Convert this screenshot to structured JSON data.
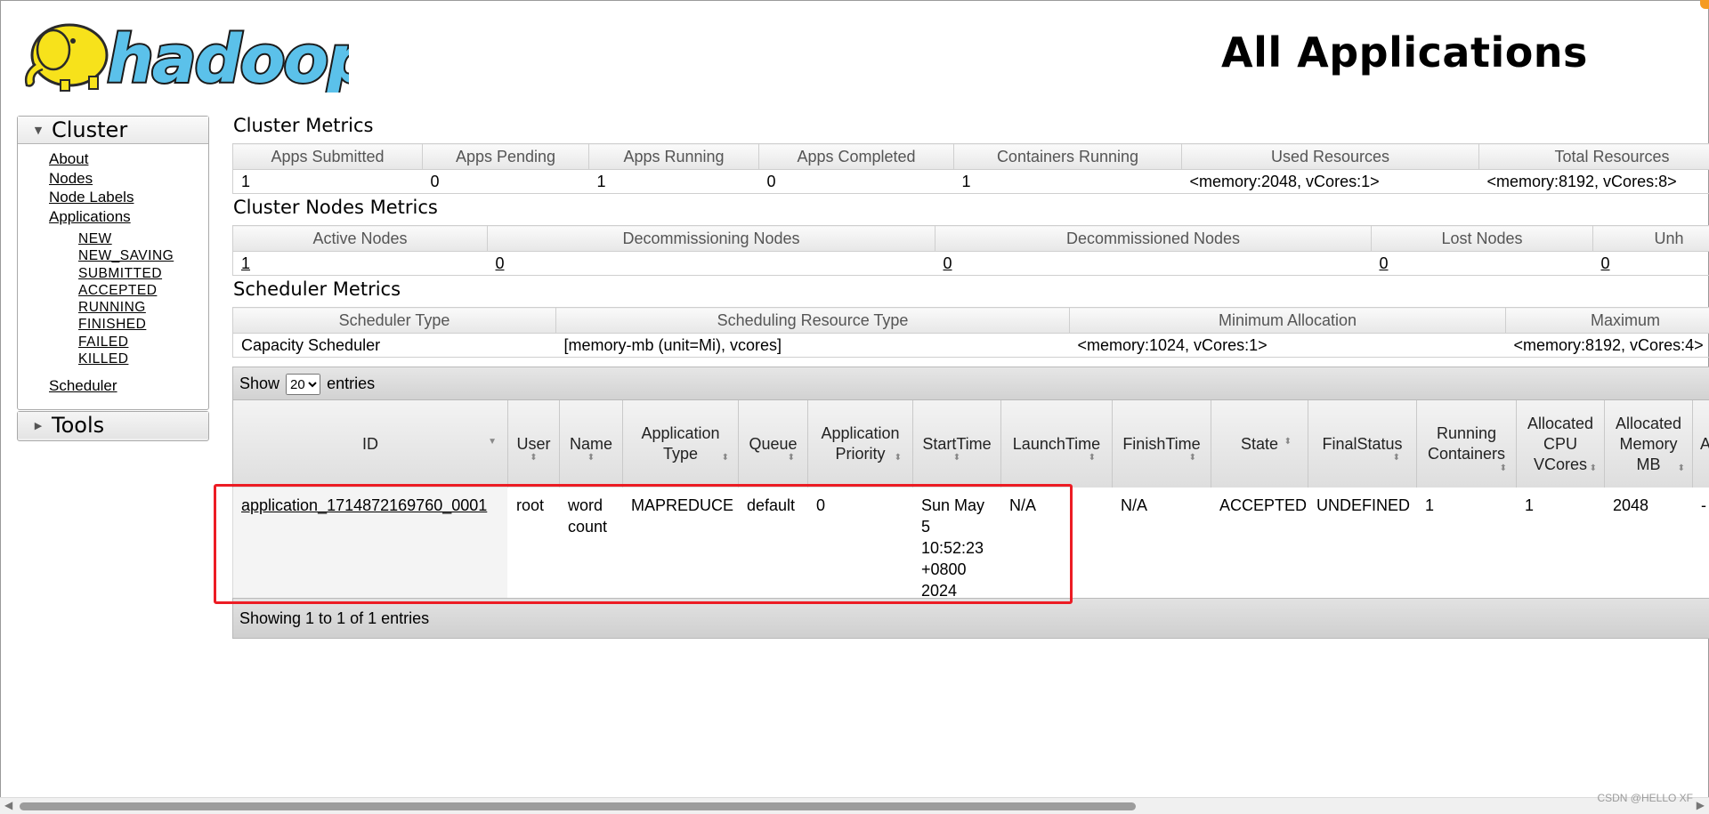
{
  "header": {
    "logo_text": "hadoop",
    "title": "All Applications"
  },
  "sidebar": {
    "cluster_label": "Cluster",
    "links": [
      "About",
      "Nodes",
      "Node Labels",
      "Applications"
    ],
    "app_states": [
      "NEW",
      "NEW_SAVING",
      "SUBMITTED",
      "ACCEPTED",
      "RUNNING",
      "FINISHED",
      "FAILED",
      "KILLED"
    ],
    "scheduler": "Scheduler",
    "tools_label": "Tools"
  },
  "cluster_metrics": {
    "title": "Cluster Metrics",
    "headers": [
      "Apps Submitted",
      "Apps Pending",
      "Apps Running",
      "Apps Completed",
      "Containers Running",
      "Used Resources",
      "Total Resources"
    ],
    "values": [
      "1",
      "0",
      "1",
      "0",
      "1",
      "<memory:2048, vCores:1>",
      "<memory:8192, vCores:8>"
    ]
  },
  "nodes_metrics": {
    "title": "Cluster Nodes Metrics",
    "headers": [
      "Active Nodes",
      "Decommissioning Nodes",
      "Decommissioned Nodes",
      "Lost Nodes",
      "Unh"
    ],
    "values": [
      "1",
      "0",
      "0",
      "0",
      "0"
    ]
  },
  "scheduler_metrics": {
    "title": "Scheduler Metrics",
    "headers": [
      "Scheduler Type",
      "Scheduling Resource Type",
      "Minimum Allocation",
      "Maximum"
    ],
    "values": [
      "Capacity Scheduler",
      "[memory-mb (unit=Mi), vcores]",
      "<memory:1024, vCores:1>",
      "<memory:8192, vCores:4>"
    ]
  },
  "apps_table": {
    "show_label": "Show",
    "entries_label": "entries",
    "page_size": "20",
    "page_size_options": [
      "20"
    ],
    "columns": [
      "ID",
      "User",
      "Name",
      "Application Type",
      "Queue",
      "Application Priority",
      "StartTime",
      "LaunchTime",
      "FinishTime",
      "State",
      "FinalStatus",
      "Running Containers",
      "Allocated CPU VCores",
      "Allocated Memory MB",
      "A"
    ],
    "rows": [
      {
        "id": "application_1714872169760_0001",
        "user": "root",
        "name": "word count",
        "type": "MAPREDUCE",
        "queue": "default",
        "priority": "0",
        "start_time": "Sun May 5 10:52:23 +0800 2024",
        "launch_time": "N/A",
        "finish_time": "N/A",
        "state": "ACCEPTED",
        "final_status": "UNDEFINED",
        "running_containers": "1",
        "allocated_vcores": "1",
        "allocated_memory": "2048",
        "extra": "-"
      }
    ],
    "footer": "Showing 1 to 1 of 1 entries"
  },
  "watermark": "CSDN @HELLO XF",
  "colors": {
    "highlight": "#ec1c24",
    "logo_yellow": "#f7e21b",
    "logo_blue": "#5bc1ea"
  }
}
